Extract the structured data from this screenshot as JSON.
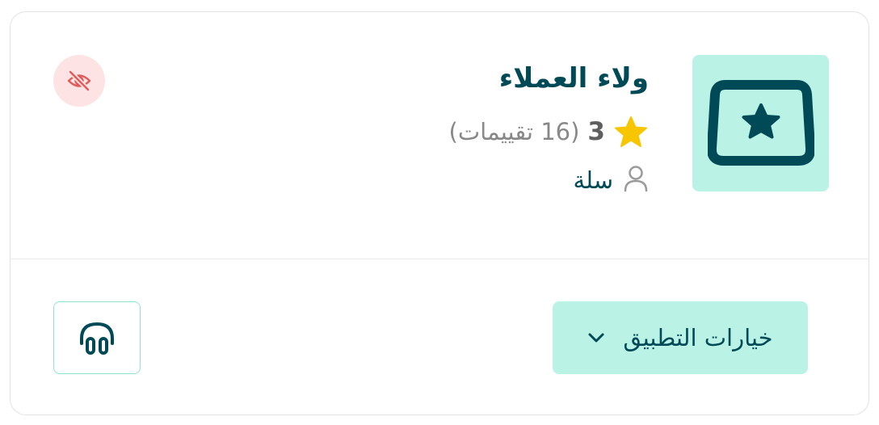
{
  "app": {
    "title": "ولاء العملاء",
    "rating_value": "3",
    "rating_count": "(16 تقييمات)",
    "developer": "سلة",
    "icon": "star-frame-icon"
  },
  "actions": {
    "options_label": "خيارات التطبيق",
    "options_icon": "chevron-down-icon",
    "support_icon": "headphones-icon",
    "hidden_icon": "eye-off-icon"
  },
  "colors": {
    "brand_dark": "#004956",
    "brand_light": "#baf3e6",
    "star": "#f7c600",
    "danger_bg": "#fde3e3",
    "danger": "#e05a5a"
  }
}
